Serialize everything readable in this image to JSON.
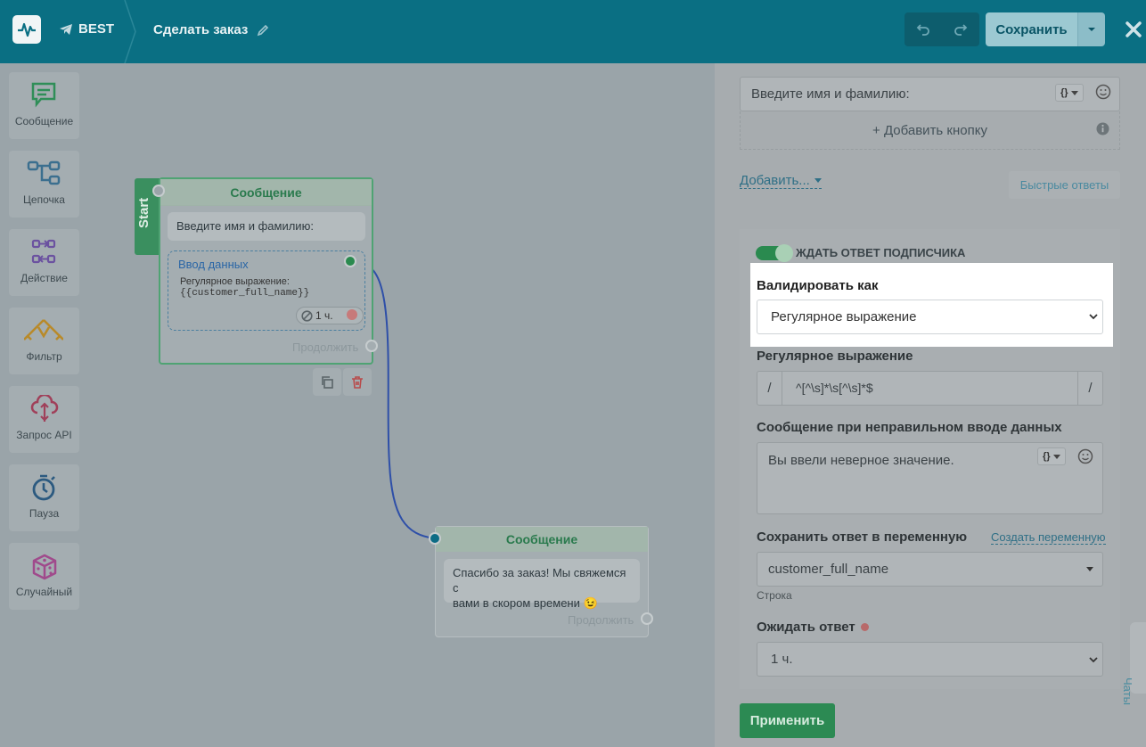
{
  "header": {
    "bot_name": "BEST",
    "flow_title": "Сделать заказ",
    "save_label": "Сохранить"
  },
  "toolbox": [
    {
      "label": "Сообщение",
      "icon": "message-icon"
    },
    {
      "label": "Цепочка",
      "icon": "chain-icon"
    },
    {
      "label": "Действие",
      "icon": "action-icon"
    },
    {
      "label": "Фильтр",
      "icon": "filter-icon"
    },
    {
      "label": "Запрос API",
      "icon": "api-request-icon"
    },
    {
      "label": "Пауза",
      "icon": "pause-timer-icon"
    },
    {
      "label": "Случайный",
      "icon": "dice-icon"
    }
  ],
  "canvas": {
    "start_label": "Start",
    "node1": {
      "title": "Сообщение",
      "message": "Введите имя и фамилию:",
      "input_title": "Ввод данных",
      "input_desc_line1": "Регулярное выражение:",
      "input_desc_line2": "{{customer_full_name}}",
      "timeout": "1 ч.",
      "continue": "Продолжить"
    },
    "node2": {
      "title": "Сообщение",
      "message_line1": "Спасибо за заказ! Мы свяжемся с",
      "message_line2": "вами в скором времени 😉",
      "continue": "Продолжить"
    }
  },
  "panel": {
    "message_text": "Введите имя и фамилию:",
    "add_button": "+ Добавить кнопку",
    "add_dropdown": "Добавить...",
    "quick_replies": "Быстрые ответы",
    "wait_reply_toggle": "ЖДАТЬ ОТВЕТ ПОДПИСЧИКА",
    "validate_label": "Валидировать как",
    "validate_value": "Регулярное выражение",
    "regex_label": "Регулярное выражение",
    "regex_prefix": "/",
    "regex_value": "^[^\\s]*\\s[^\\s]*$",
    "regex_suffix": "/",
    "error_msg_label": "Сообщение при неправильном вводе данных",
    "error_msg_value": "Вы ввели неверное значение.",
    "save_var_label": "Сохранить ответ в переменную",
    "create_var_link": "Создать переменную",
    "var_value": "customer_full_name",
    "var_type": "Строка",
    "wait_label": "Ожидать ответ",
    "wait_value": "1 ч.",
    "apply_label": "Применить",
    "chats_tab": "Чаты"
  },
  "colors": {
    "header_bg": "#0a6f83",
    "accent_green": "#2c8a53",
    "link_blue": "#2f7a96"
  }
}
